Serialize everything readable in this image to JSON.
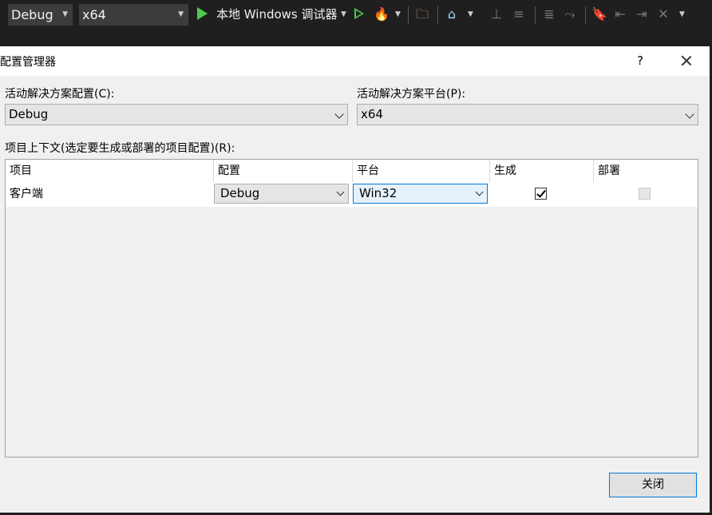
{
  "toolbar": {
    "config": "Debug",
    "platform": "x64",
    "debugger": "本地 Windows 调试器"
  },
  "dialog": {
    "title": "配置管理器",
    "help": "?",
    "active_config_label": "活动解决方案配置(C):",
    "active_config_value": "Debug",
    "active_platform_label": "活动解决方案平台(P):",
    "active_platform_value": "x64",
    "context_label": "项目上下文(选定要生成或部署的项目配置)(R):",
    "columns": [
      "项目",
      "配置",
      "平台",
      "生成",
      "部署"
    ],
    "rows": [
      {
        "project": "客户端",
        "config": "Debug",
        "platform": "Win32",
        "build": true,
        "deploy": false
      }
    ],
    "close_label": "关闭"
  }
}
